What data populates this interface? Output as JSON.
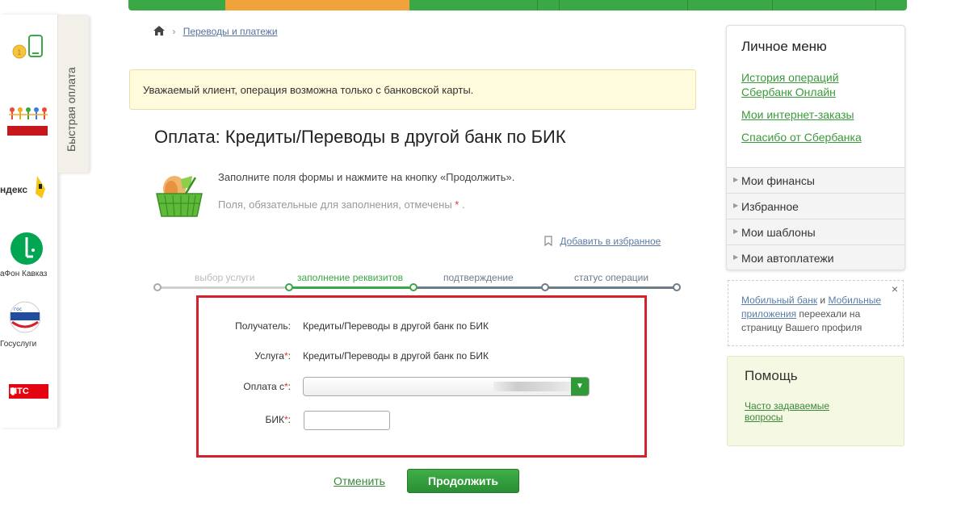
{
  "nav": {
    "accent": "#3aa845",
    "active_color": "#f2a23a"
  },
  "sidebar": {
    "tab_label": "Быстрая оплата",
    "items": [
      {
        "icon": "phone-icon"
      },
      {
        "icon": "charity-people-icon"
      },
      {
        "icon": "yandex-logo",
        "label": "ндекс"
      },
      {
        "icon": "megafon-logo",
        "label": "аФон Кавказ"
      },
      {
        "icon": "gosuslugi-logo",
        "label": "Госуслуги"
      },
      {
        "icon": "mts-logo",
        "label": "МТС"
      }
    ]
  },
  "breadcrumb": {
    "link": "Переводы и платежи"
  },
  "warning": "Уважаемый клиент, операция возможна только с банковской карты.",
  "title": "Оплата: Кредиты/Переводы в другой банк по БИК",
  "hint": {
    "line1": "Заполните поля формы и нажмите на кнопку «Продолжить».",
    "line2": "Поля, обязательные для заполнения, отмечены",
    "req_mark": "*",
    "line2_end": "."
  },
  "favorites_link": "Добавить в избранное",
  "steps": [
    {
      "label": "выбор услуги",
      "state": "done"
    },
    {
      "label": "заполнение реквизитов",
      "state": "active"
    },
    {
      "label": "подтверждение",
      "state": "pending"
    },
    {
      "label": "статус операции",
      "state": "pending"
    }
  ],
  "form": {
    "recipient_label": "Получатель:",
    "recipient_value": "Кредиты/Переводы в другой банк по БИК",
    "service_label": "Услуга",
    "service_value": "Кредиты/Переводы в другой банк по БИК",
    "pay_from_label": "Оплата с",
    "bik_label": "БИК",
    "req_mark": "*",
    "colon": ":"
  },
  "buttons": {
    "cancel": "Отменить",
    "continue": "Продолжить"
  },
  "personal_menu": {
    "title": "Личное меню",
    "links": [
      "История операций Сбербанк Онлайн",
      "Мои интернет-заказы",
      "Спасибо от Сбербанка"
    ],
    "sections": [
      "Мои финансы",
      "Избранное",
      "Мои шаблоны",
      "Мои автоплатежи"
    ]
  },
  "notice": {
    "link1": "Мобильный банк",
    "and": " и ",
    "link2": "Мобильные приложения",
    "rest": " переехали на страницу Вашего профиля",
    "close": "×"
  },
  "help": {
    "title": "Помощь",
    "faq_link": "Часто задаваемые вопросы"
  },
  "colors": {
    "green": "#3aa845",
    "red_frame": "#d6202c",
    "link_green": "#3a9a3a"
  }
}
